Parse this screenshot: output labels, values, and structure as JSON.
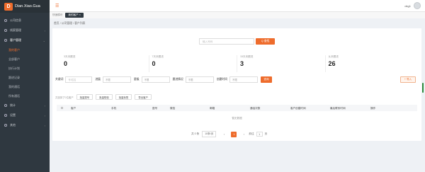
{
  "brand": {
    "logo_letter": "D",
    "name": "Dian.Xiao.Gua"
  },
  "sidebar": {
    "items": [
      {
        "label": "公司信息",
        "icon": "home-icon"
      },
      {
        "label": "线索管理",
        "icon": "list-icon"
      },
      {
        "label": "客户管理",
        "icon": "user-icon",
        "open": true,
        "children": [
          "我的客户",
          "全部客户",
          "执行计划",
          "跟进记录",
          "我的通话",
          "所有通话"
        ],
        "active_child": "我的客户"
      },
      {
        "label": "统计",
        "icon": "chart-icon"
      },
      {
        "label": "设置",
        "icon": "gear-icon"
      },
      {
        "label": "其他",
        "icon": "grid-icon"
      }
    ]
  },
  "topbar": {
    "username": "dxg1"
  },
  "tabs": [
    {
      "label": "快速模块",
      "active": false
    },
    {
      "label": "我的客户 ×",
      "active": true
    }
  ],
  "breadcrumb": "首页  /  公司管理  /  客户列表",
  "search": {
    "placeholder": "输入号码",
    "button": "Q 查找"
  },
  "stats": [
    {
      "label": "3天未跟进",
      "value": "0"
    },
    {
      "label": "7天未跟进",
      "value": "0"
    },
    {
      "label": "15天未跟进",
      "value": "3"
    },
    {
      "label": "从未跟进",
      "value": "26"
    }
  ],
  "filters": {
    "keyword_label": "关键词",
    "keyword_placeholder": "号/姓名",
    "status_label": "进展",
    "status_value": "不限",
    "level_label": "星级",
    "level_value": "不限",
    "follow_label": "跟进情况",
    "follow_value": "不限",
    "time_label": "创建时间",
    "time_value": "不限",
    "query_button": "查询",
    "import_button": "+ 导入"
  },
  "actions": {
    "selected_info": "共选择了0位客户",
    "batch_call": "批量拨号",
    "batch_sms": "批量短信",
    "batch_tag": "批量标签",
    "export": "导出客户"
  },
  "table": {
    "headers": [
      "客户",
      "手机",
      "座号",
      "微信",
      "邮箱",
      "通话次数",
      "客户创建时间",
      "最后联系时间",
      "操作"
    ],
    "empty_text": "暂无数据"
  },
  "pager": {
    "total": "共 0 条",
    "page_size": "10条/页",
    "prev": "‹",
    "current": "1",
    "next": "›",
    "goto_label": "前往",
    "goto_value": "1",
    "goto_suffix": "页"
  },
  "colors": {
    "accent": "#ee6c2c",
    "sidebar": "#2f3840"
  }
}
